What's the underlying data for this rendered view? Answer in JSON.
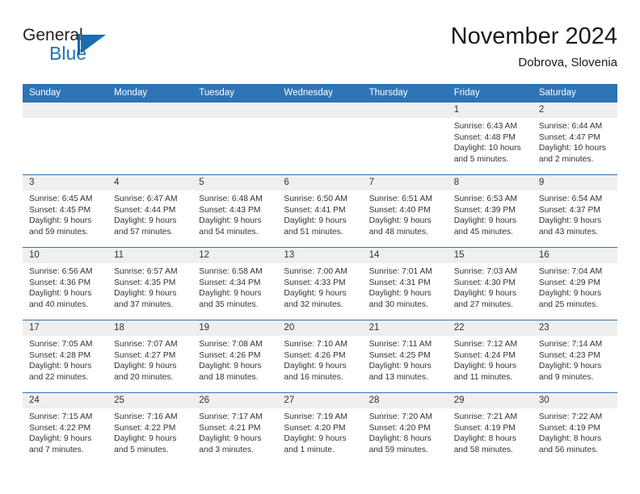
{
  "logo": {
    "word1": "General",
    "word2": "Blue",
    "mark": "triangle-logo-icon",
    "accent_color": "#1b75bb"
  },
  "header": {
    "title": "November 2024",
    "subtitle": "Dobrova, Slovenia",
    "header_bg_color": "#2e74b5",
    "daynum_bg_color": "#efefef"
  },
  "weekday_headers": [
    "Sunday",
    "Monday",
    "Tuesday",
    "Wednesday",
    "Thursday",
    "Friday",
    "Saturday"
  ],
  "labels": {
    "sunrise_prefix": "Sunrise:",
    "sunset_prefix": "Sunset:",
    "daylight_prefix": "Daylight:"
  },
  "weeks": [
    [
      {
        "day": "",
        "sunrise": "",
        "sunset": "",
        "daylight_line1": "",
        "daylight_line2": ""
      },
      {
        "day": "",
        "sunrise": "",
        "sunset": "",
        "daylight_line1": "",
        "daylight_line2": ""
      },
      {
        "day": "",
        "sunrise": "",
        "sunset": "",
        "daylight_line1": "",
        "daylight_line2": ""
      },
      {
        "day": "",
        "sunrise": "",
        "sunset": "",
        "daylight_line1": "",
        "daylight_line2": ""
      },
      {
        "day": "",
        "sunrise": "",
        "sunset": "",
        "daylight_line1": "",
        "daylight_line2": ""
      },
      {
        "day": "1",
        "sunrise": "Sunrise: 6:43 AM",
        "sunset": "Sunset: 4:48 PM",
        "daylight_line1": "Daylight: 10 hours",
        "daylight_line2": "and 5 minutes."
      },
      {
        "day": "2",
        "sunrise": "Sunrise: 6:44 AM",
        "sunset": "Sunset: 4:47 PM",
        "daylight_line1": "Daylight: 10 hours",
        "daylight_line2": "and 2 minutes."
      }
    ],
    [
      {
        "day": "3",
        "sunrise": "Sunrise: 6:45 AM",
        "sunset": "Sunset: 4:45 PM",
        "daylight_line1": "Daylight: 9 hours",
        "daylight_line2": "and 59 minutes."
      },
      {
        "day": "4",
        "sunrise": "Sunrise: 6:47 AM",
        "sunset": "Sunset: 4:44 PM",
        "daylight_line1": "Daylight: 9 hours",
        "daylight_line2": "and 57 minutes."
      },
      {
        "day": "5",
        "sunrise": "Sunrise: 6:48 AM",
        "sunset": "Sunset: 4:43 PM",
        "daylight_line1": "Daylight: 9 hours",
        "daylight_line2": "and 54 minutes."
      },
      {
        "day": "6",
        "sunrise": "Sunrise: 6:50 AM",
        "sunset": "Sunset: 4:41 PM",
        "daylight_line1": "Daylight: 9 hours",
        "daylight_line2": "and 51 minutes."
      },
      {
        "day": "7",
        "sunrise": "Sunrise: 6:51 AM",
        "sunset": "Sunset: 4:40 PM",
        "daylight_line1": "Daylight: 9 hours",
        "daylight_line2": "and 48 minutes."
      },
      {
        "day": "8",
        "sunrise": "Sunrise: 6:53 AM",
        "sunset": "Sunset: 4:39 PM",
        "daylight_line1": "Daylight: 9 hours",
        "daylight_line2": "and 45 minutes."
      },
      {
        "day": "9",
        "sunrise": "Sunrise: 6:54 AM",
        "sunset": "Sunset: 4:37 PM",
        "daylight_line1": "Daylight: 9 hours",
        "daylight_line2": "and 43 minutes."
      }
    ],
    [
      {
        "day": "10",
        "sunrise": "Sunrise: 6:56 AM",
        "sunset": "Sunset: 4:36 PM",
        "daylight_line1": "Daylight: 9 hours",
        "daylight_line2": "and 40 minutes."
      },
      {
        "day": "11",
        "sunrise": "Sunrise: 6:57 AM",
        "sunset": "Sunset: 4:35 PM",
        "daylight_line1": "Daylight: 9 hours",
        "daylight_line2": "and 37 minutes."
      },
      {
        "day": "12",
        "sunrise": "Sunrise: 6:58 AM",
        "sunset": "Sunset: 4:34 PM",
        "daylight_line1": "Daylight: 9 hours",
        "daylight_line2": "and 35 minutes."
      },
      {
        "day": "13",
        "sunrise": "Sunrise: 7:00 AM",
        "sunset": "Sunset: 4:33 PM",
        "daylight_line1": "Daylight: 9 hours",
        "daylight_line2": "and 32 minutes."
      },
      {
        "day": "14",
        "sunrise": "Sunrise: 7:01 AM",
        "sunset": "Sunset: 4:31 PM",
        "daylight_line1": "Daylight: 9 hours",
        "daylight_line2": "and 30 minutes."
      },
      {
        "day": "15",
        "sunrise": "Sunrise: 7:03 AM",
        "sunset": "Sunset: 4:30 PM",
        "daylight_line1": "Daylight: 9 hours",
        "daylight_line2": "and 27 minutes."
      },
      {
        "day": "16",
        "sunrise": "Sunrise: 7:04 AM",
        "sunset": "Sunset: 4:29 PM",
        "daylight_line1": "Daylight: 9 hours",
        "daylight_line2": "and 25 minutes."
      }
    ],
    [
      {
        "day": "17",
        "sunrise": "Sunrise: 7:05 AM",
        "sunset": "Sunset: 4:28 PM",
        "daylight_line1": "Daylight: 9 hours",
        "daylight_line2": "and 22 minutes."
      },
      {
        "day": "18",
        "sunrise": "Sunrise: 7:07 AM",
        "sunset": "Sunset: 4:27 PM",
        "daylight_line1": "Daylight: 9 hours",
        "daylight_line2": "and 20 minutes."
      },
      {
        "day": "19",
        "sunrise": "Sunrise: 7:08 AM",
        "sunset": "Sunset: 4:26 PM",
        "daylight_line1": "Daylight: 9 hours",
        "daylight_line2": "and 18 minutes."
      },
      {
        "day": "20",
        "sunrise": "Sunrise: 7:10 AM",
        "sunset": "Sunset: 4:26 PM",
        "daylight_line1": "Daylight: 9 hours",
        "daylight_line2": "and 16 minutes."
      },
      {
        "day": "21",
        "sunrise": "Sunrise: 7:11 AM",
        "sunset": "Sunset: 4:25 PM",
        "daylight_line1": "Daylight: 9 hours",
        "daylight_line2": "and 13 minutes."
      },
      {
        "day": "22",
        "sunrise": "Sunrise: 7:12 AM",
        "sunset": "Sunset: 4:24 PM",
        "daylight_line1": "Daylight: 9 hours",
        "daylight_line2": "and 11 minutes."
      },
      {
        "day": "23",
        "sunrise": "Sunrise: 7:14 AM",
        "sunset": "Sunset: 4:23 PM",
        "daylight_line1": "Daylight: 9 hours",
        "daylight_line2": "and 9 minutes."
      }
    ],
    [
      {
        "day": "24",
        "sunrise": "Sunrise: 7:15 AM",
        "sunset": "Sunset: 4:22 PM",
        "daylight_line1": "Daylight: 9 hours",
        "daylight_line2": "and 7 minutes."
      },
      {
        "day": "25",
        "sunrise": "Sunrise: 7:16 AM",
        "sunset": "Sunset: 4:22 PM",
        "daylight_line1": "Daylight: 9 hours",
        "daylight_line2": "and 5 minutes."
      },
      {
        "day": "26",
        "sunrise": "Sunrise: 7:17 AM",
        "sunset": "Sunset: 4:21 PM",
        "daylight_line1": "Daylight: 9 hours",
        "daylight_line2": "and 3 minutes."
      },
      {
        "day": "27",
        "sunrise": "Sunrise: 7:19 AM",
        "sunset": "Sunset: 4:20 PM",
        "daylight_line1": "Daylight: 9 hours",
        "daylight_line2": "and 1 minute."
      },
      {
        "day": "28",
        "sunrise": "Sunrise: 7:20 AM",
        "sunset": "Sunset: 4:20 PM",
        "daylight_line1": "Daylight: 8 hours",
        "daylight_line2": "and 59 minutes."
      },
      {
        "day": "29",
        "sunrise": "Sunrise: 7:21 AM",
        "sunset": "Sunset: 4:19 PM",
        "daylight_line1": "Daylight: 8 hours",
        "daylight_line2": "and 58 minutes."
      },
      {
        "day": "30",
        "sunrise": "Sunrise: 7:22 AM",
        "sunset": "Sunset: 4:19 PM",
        "daylight_line1": "Daylight: 8 hours",
        "daylight_line2": "and 56 minutes."
      }
    ]
  ]
}
